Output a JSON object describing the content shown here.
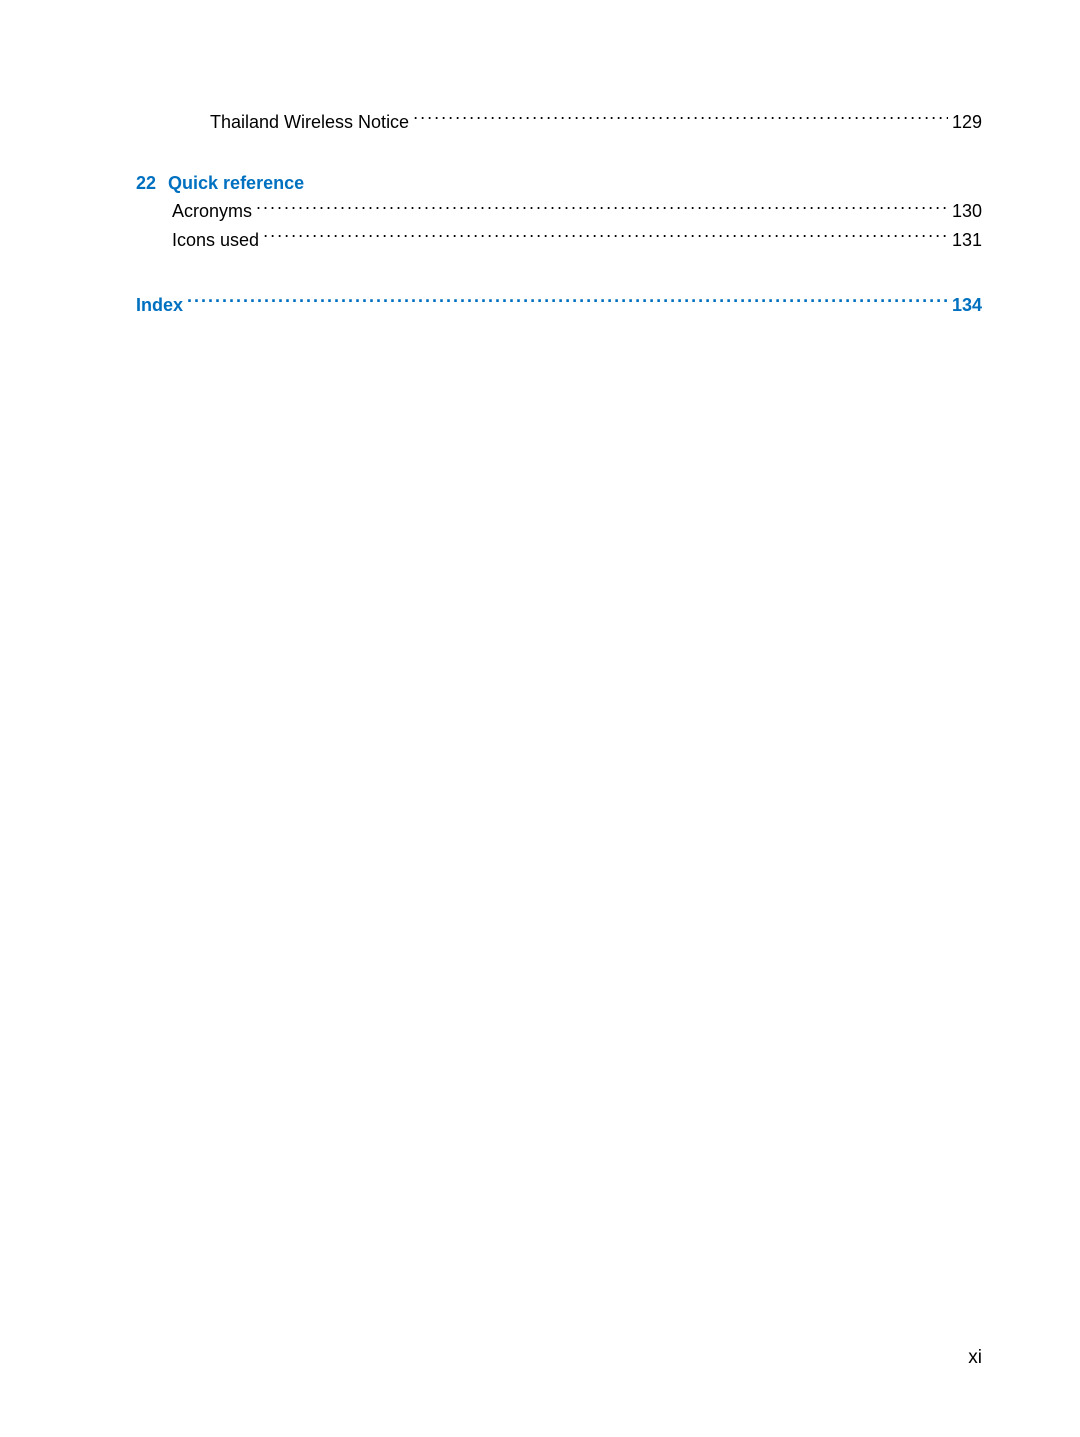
{
  "toc": {
    "orphan_entry": {
      "label": "Thailand Wireless Notice",
      "page": "129"
    },
    "section22": {
      "num": "22",
      "title": "Quick reference",
      "entries": [
        {
          "label": "Acronyms",
          "page": "130"
        },
        {
          "label": "Icons used",
          "page": "131"
        }
      ]
    },
    "index": {
      "label": "Index",
      "page": "134"
    }
  },
  "footer": {
    "page_label": "xi"
  }
}
